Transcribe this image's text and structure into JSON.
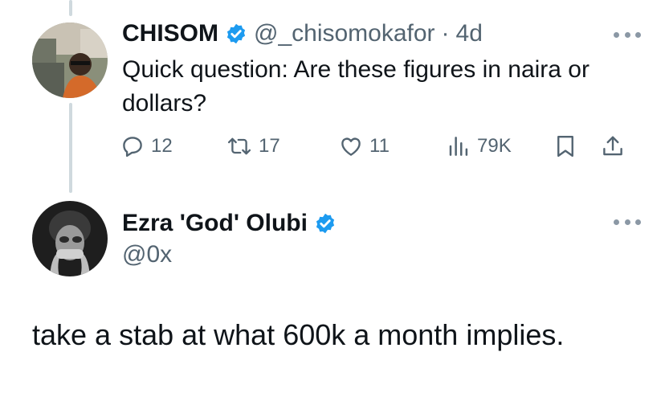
{
  "tweet1": {
    "author_name": "CHISOM",
    "handle": "@_chisomokafor",
    "separator": "·",
    "time": "4d",
    "text": "Quick question: Are these figures in naira or dollars?",
    "avatar_icon": "person-photo-avatar",
    "stats": {
      "replies": "12",
      "reposts": "17",
      "likes": "11",
      "views": "79K"
    }
  },
  "tweet2": {
    "author_name": "Ezra 'God' Olubi",
    "handle": "@0x",
    "text": "take a stab at what 600k a month implies.",
    "avatar_icon": "person-photo-avatar"
  },
  "colors": {
    "text_primary": "#0f1419",
    "text_secondary": "#536471",
    "verified_blue": "#1d9bf0",
    "thread_line": "#cfd9de"
  },
  "icons": [
    "verified-badge-icon",
    "reply-icon",
    "repost-icon",
    "like-icon",
    "views-icon",
    "bookmark-icon",
    "share-icon",
    "more-icon"
  ]
}
